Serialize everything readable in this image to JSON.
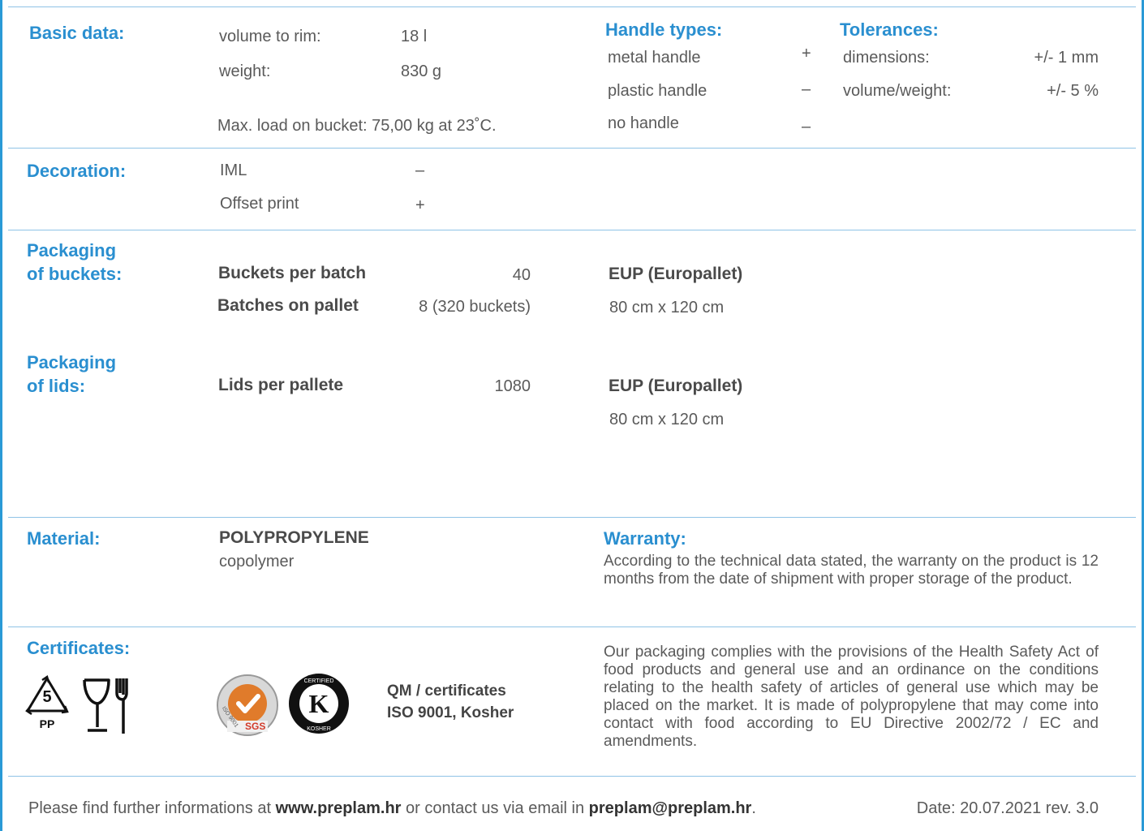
{
  "basic": {
    "heading": "Basic data:",
    "volume_label": "volume to rim:",
    "volume_value": "18 l",
    "weight_label": "weight:",
    "weight_value": "830 g",
    "max_load": "Max. load on bucket: 75,00 kg at 23˚C."
  },
  "handles": {
    "heading": "Handle types:",
    "items": [
      {
        "label": "metal handle",
        "mark": "+"
      },
      {
        "label": "plastic handle",
        "mark": "–"
      },
      {
        "label": "no handle",
        "mark": "–"
      }
    ]
  },
  "tolerances": {
    "heading": "Tolerances:",
    "items": [
      {
        "label": "dimensions:",
        "value": "+/- 1 mm"
      },
      {
        "label": "volume/weight:",
        "value": "+/- 5 %"
      }
    ]
  },
  "decoration": {
    "heading": "Decoration:",
    "items": [
      {
        "label": "IML",
        "mark": "–"
      },
      {
        "label": "Offset print",
        "mark": "+"
      }
    ]
  },
  "pack_buckets": {
    "heading_1": "Packaging",
    "heading_2": "of buckets:",
    "per_batch_label": "Buckets per batch",
    "per_batch_value": "40",
    "batches_label": "Batches on pallet",
    "batches_value": "8 (320 buckets)",
    "pallet_label": "EUP (Europallet)",
    "pallet_size": "80 cm x 120 cm"
  },
  "pack_lids": {
    "heading_1": "Packaging",
    "heading_2": "of lids:",
    "per_pallet_label": "Lids per pallete",
    "per_pallet_value": "1080",
    "pallet_label": "EUP (Europallet)",
    "pallet_size": "80 cm x 120 cm"
  },
  "material": {
    "heading": "Material:",
    "name": "POLYPROPYLENE",
    "sub": "copolymer"
  },
  "warranty": {
    "heading": "Warranty:",
    "text": "According to the technical data stated, the warranty on the product is 12 months from the date of shipment with proper storage of the product."
  },
  "certificates": {
    "heading": "Certificates:",
    "recycle_code": "5",
    "recycle_material": "PP",
    "sgs_text": "SGS",
    "iso_text": "ISO 9001",
    "qm_line1": "QM / certificates",
    "qm_line2": "ISO 9001, Kosher",
    "compliance": "Our packaging complies with the provisions of the Health Safety Act of food products and general use and an ordinance on the conditions relating to the health safety of articles of general use which may be placed on the market. It is made of polypropylene that may come into contact with food according to EU Directive 2002/72 / EC and amendments."
  },
  "footer": {
    "text1": "Please find further informations at ",
    "website": "www.preplam.hr",
    "text2": " or contact us via email in ",
    "email": "preplam@preplam.hr",
    "text3": ".",
    "date": "Date: 20.07.2021 rev. 3.0"
  },
  "colors": {
    "accent": "#2a8fd0",
    "divider": "#8fc3e6",
    "text": "#5a5a5a"
  }
}
